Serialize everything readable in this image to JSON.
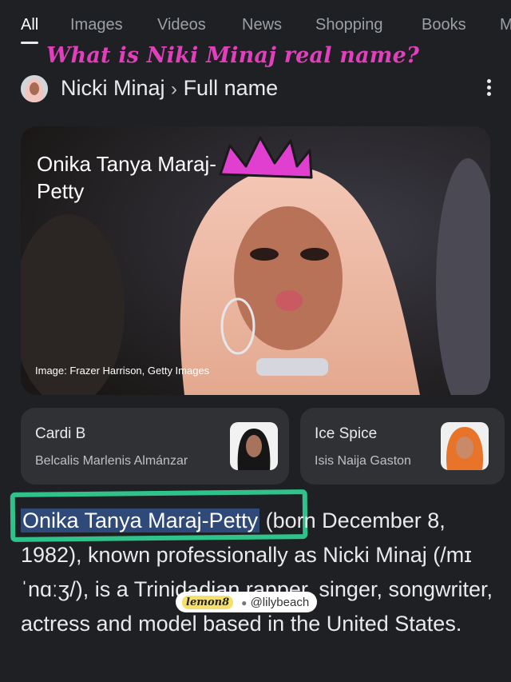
{
  "tabs": [
    "All",
    "Images",
    "Videos",
    "News",
    "Shopping",
    "Books",
    "M"
  ],
  "overlay_title": "What is Niki Minaj real name?",
  "breadcrumb": {
    "entity": "Nicki Minaj",
    "separator": "›",
    "attribute": "Full name"
  },
  "hero": {
    "name": "Onika Tanya Maraj-Petty",
    "credit": "Image: Frazer Harrison, Getty Images"
  },
  "related": [
    {
      "title": "Cardi B",
      "subtitle": "Belcalis Marlenis Almánzar"
    },
    {
      "title": "Ice Spice",
      "subtitle": "Isis Naija Gaston"
    }
  ],
  "description": {
    "highlight": "Onika Tanya Maraj-Petty",
    "rest": " (born December 8, 1982), known professionally as Nicki Minaj (/mɪˈnɑːʒ/), is a Trinidadian rapper, singer, songwriter, actress and model based in the United States."
  },
  "watermark": {
    "brand": "lemon8",
    "user": "@lilybeach"
  },
  "colors": {
    "background": "#1f2023",
    "overlay_title": "#e23fbc",
    "highlight": "#2f4a78",
    "annotation_box": "#2fc28a",
    "crown": "#e03fd0"
  }
}
